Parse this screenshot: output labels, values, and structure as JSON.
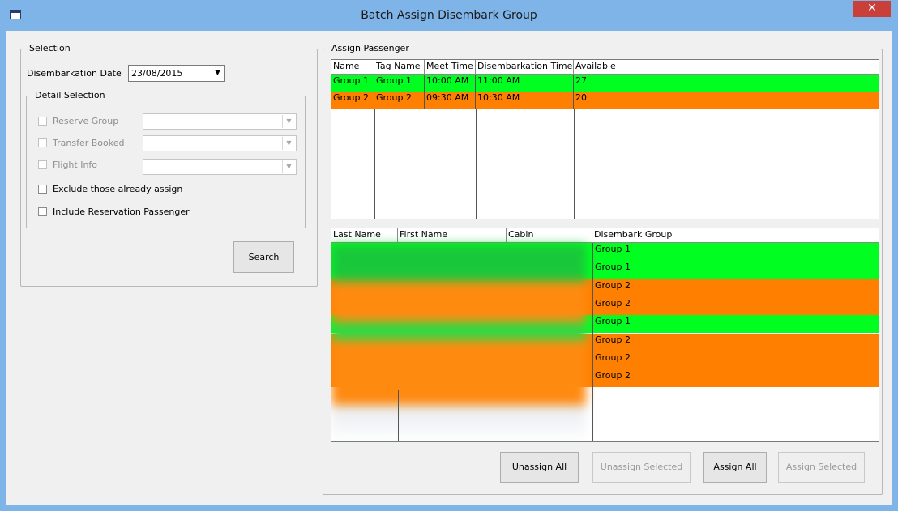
{
  "window": {
    "title": "Batch Assign Disembark Group",
    "close_symbol": "✕"
  },
  "colors": {
    "green": "#00ff21",
    "orange": "#ff8000",
    "titlebar": "#7fb4e8",
    "close": "#c9403a"
  },
  "selection": {
    "label": "Selection",
    "date_label": "Disembarkation Date",
    "date_value": "23/08/2015",
    "detail": {
      "label": "Detail Selection",
      "reserve_group": "Reserve Group",
      "transfer_booked": "Transfer Booked",
      "flight_info": "Flight Info",
      "exclude_assigned": "Exclude those already assign",
      "include_reservation": "Include Reservation Passenger"
    },
    "search_label": "Search"
  },
  "assign": {
    "label": "Assign Passenger",
    "groups_table": {
      "columns": [
        "Name",
        "Tag Name",
        "Meet Time",
        "Disembarkation Time",
        "Available"
      ],
      "rows": [
        {
          "name": "Group 1",
          "tag": "Group 1",
          "meet": "10:00 AM",
          "disembark": "11:00 AM",
          "available": "27",
          "color": "green"
        },
        {
          "name": "Group 2",
          "tag": "Group 2",
          "meet": "09:30 AM",
          "disembark": "10:30 AM",
          "available": "20",
          "color": "orange"
        }
      ]
    },
    "passengers_table": {
      "columns": [
        "Last Name",
        "First Name",
        "Cabin",
        "Disembark Group"
      ],
      "rows": [
        {
          "group": "Group 1",
          "color": "green"
        },
        {
          "group": "Group 1",
          "color": "green"
        },
        {
          "group": "Group 2",
          "color": "orange"
        },
        {
          "group": "Group 2",
          "color": "orange"
        },
        {
          "group": "Group 1",
          "color": "green"
        },
        {
          "group": "Group 2",
          "color": "orange"
        },
        {
          "group": "Group 2",
          "color": "orange"
        },
        {
          "group": "Group 2",
          "color": "orange"
        }
      ]
    },
    "buttons": {
      "unassign_all": "Unassign All",
      "unassign_selected": "Unassign Selected",
      "assign_all": "Assign All",
      "assign_selected": "Assign Selected"
    }
  }
}
